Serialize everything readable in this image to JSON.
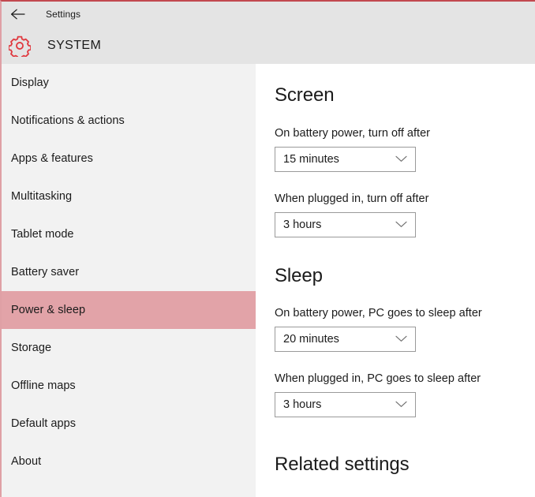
{
  "window": {
    "accent_color": "#c2484f",
    "header_bg": "#e4e4e4",
    "sidebar_bg": "#f2f2f2",
    "selected_bg": "#e2a3a8"
  },
  "titlebar": {
    "back_icon": "back-arrow-icon",
    "title": "Settings"
  },
  "category": {
    "icon": "gear-icon",
    "title": "SYSTEM"
  },
  "sidebar": {
    "items": [
      {
        "label": "Display",
        "selected": false
      },
      {
        "label": "Notifications & actions",
        "selected": false
      },
      {
        "label": "Apps & features",
        "selected": false
      },
      {
        "label": "Multitasking",
        "selected": false
      },
      {
        "label": "Tablet mode",
        "selected": false
      },
      {
        "label": "Battery saver",
        "selected": false
      },
      {
        "label": "Power & sleep",
        "selected": true
      },
      {
        "label": "Storage",
        "selected": false
      },
      {
        "label": "Offline maps",
        "selected": false
      },
      {
        "label": "Default apps",
        "selected": false
      },
      {
        "label": "About",
        "selected": false
      }
    ]
  },
  "content": {
    "screen": {
      "heading": "Screen",
      "fields": [
        {
          "label": "On battery power, turn off after",
          "value": "15 minutes",
          "chevron": "chevron-down-icon"
        },
        {
          "label": "When plugged in, turn off after",
          "value": "3 hours",
          "chevron": "chevron-down-icon"
        }
      ]
    },
    "sleep": {
      "heading": "Sleep",
      "fields": [
        {
          "label": "On battery power, PC goes to sleep after",
          "value": "20 minutes",
          "chevron": "chevron-down-icon"
        },
        {
          "label": "When plugged in, PC goes to sleep after",
          "value": "3 hours",
          "chevron": "chevron-down-icon"
        }
      ]
    },
    "related": {
      "heading": "Related settings"
    }
  }
}
